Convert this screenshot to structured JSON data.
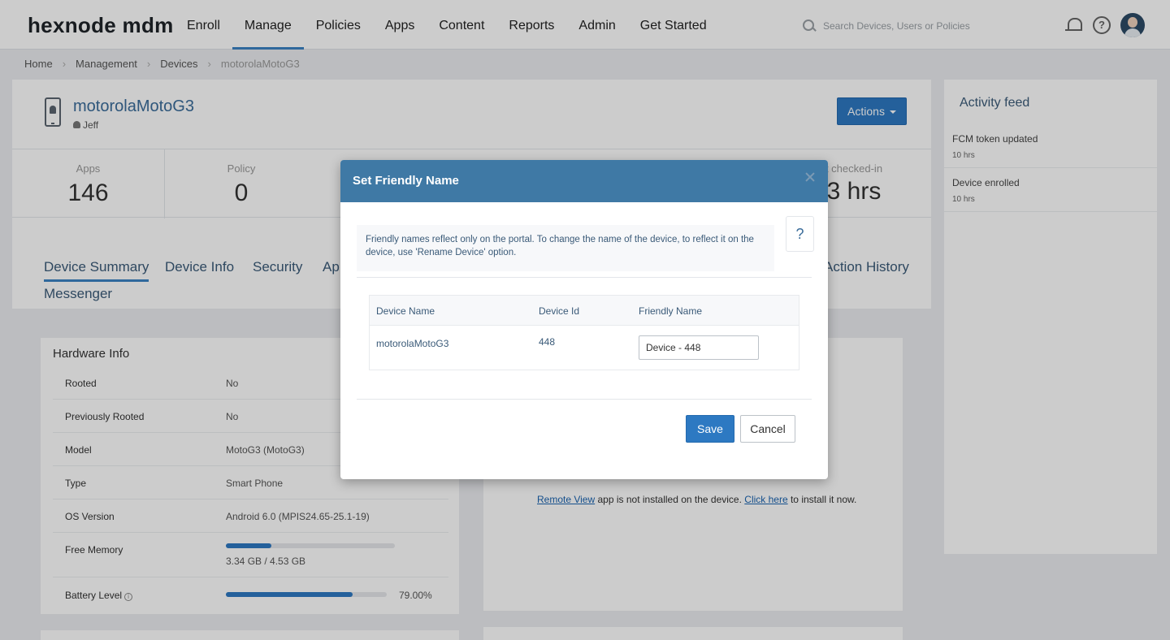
{
  "app": {
    "logo": "hexnode mdm",
    "nav": [
      "Enroll",
      "Manage",
      "Policies",
      "Apps",
      "Content",
      "Reports",
      "Admin",
      "Get Started"
    ],
    "active_nav": "Manage",
    "search_placeholder": "Search Devices, Users or Policies"
  },
  "breadcrumb": [
    "Home",
    "Management",
    "Devices",
    "motorolaMotoG3"
  ],
  "device": {
    "name": "motorolaMotoG3",
    "user": "Jeff",
    "actions_label": "Actions",
    "stats": [
      {
        "label": "Apps",
        "value": "146"
      },
      {
        "label": "Policy",
        "value": "0"
      }
    ],
    "last_stat": {
      "label": "t checked-in",
      "value": "3 hrs"
    },
    "tabs": [
      "Device Summary",
      "Device Info",
      "Security",
      "Ap",
      "Action History",
      "Messenger"
    ]
  },
  "hardware": {
    "title": "Hardware Info",
    "rows": [
      {
        "key": "Rooted",
        "value": "No"
      },
      {
        "key": "Previously Rooted",
        "value": "No"
      },
      {
        "key": "Model",
        "value": "MotoG3 (MotoG3)"
      },
      {
        "key": "Type",
        "value": "Smart Phone"
      },
      {
        "key": "OS Version",
        "value": "Android 6.0 (MPIS24.65-25.1-19)"
      },
      {
        "key": "Free Memory",
        "value": "3.34 GB / 4.53 GB",
        "fraction": 0.27
      },
      {
        "key": "Battery Level",
        "value": "79.00%",
        "fraction": 0.79
      }
    ]
  },
  "remote": {
    "link1": "Remote View",
    "text1": " app is not installed on the device. ",
    "link2": "Click here",
    "text2": " to install it now."
  },
  "feed": {
    "title": "Activity feed",
    "items": [
      {
        "title": "FCM token updated",
        "time": "10 hrs"
      },
      {
        "title": "Device enrolled",
        "time": "10 hrs"
      }
    ]
  },
  "modal": {
    "title": "Set Friendly Name",
    "note": "Friendly names reflect only on the portal. To change the name of the device, to reflect it on the device, use 'Rename Device' option.",
    "help": "?",
    "headers": [
      "Device Name",
      "Device Id",
      "Friendly Name"
    ],
    "row": {
      "device_name": "motorolaMotoG3",
      "device_id": "448",
      "friendly_name": "Device - 448"
    },
    "save": "Save",
    "cancel": "Cancel"
  },
  "colors": {
    "accent": "#2d79c2",
    "modal_header": "#3f79a5"
  },
  "icons": [
    "search-icon",
    "bell-icon",
    "help-icon",
    "avatar",
    "phone-icon",
    "user-icon",
    "caret-down-icon",
    "info-icon",
    "close-icon"
  ]
}
